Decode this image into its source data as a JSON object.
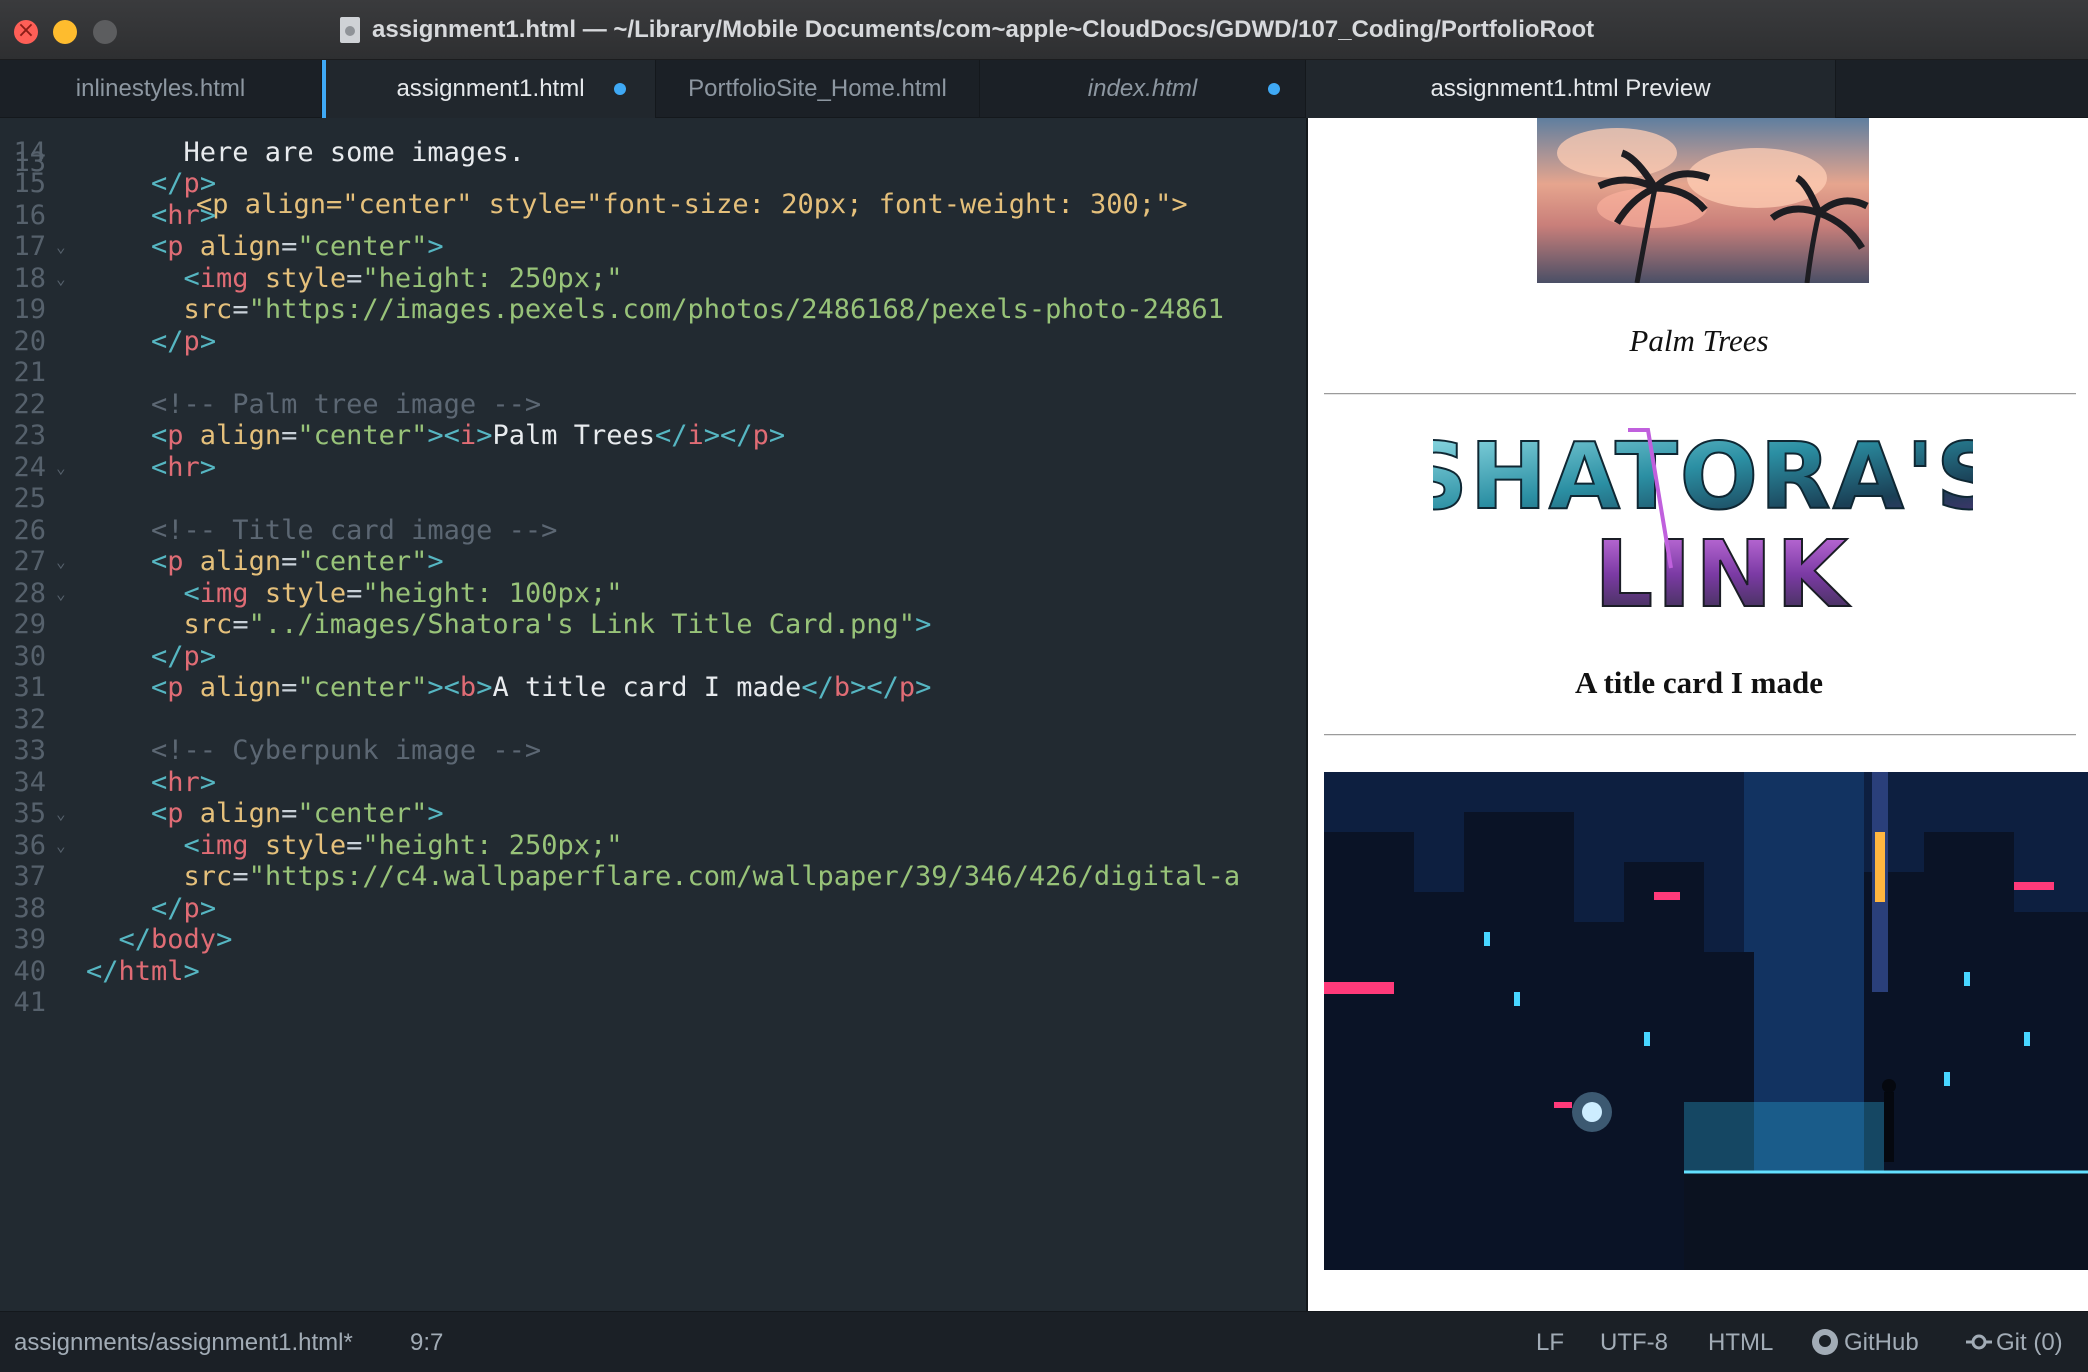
{
  "window": {
    "title": "assignment1.html — ~/Library/Mobile Documents/com~apple~CloudDocs/GDWD/107_Coding/PortfolioRoot"
  },
  "tabs": [
    {
      "label": "inlinestyles.html",
      "modified": false,
      "italic": false,
      "active": false
    },
    {
      "label": "assignment1.html",
      "modified": true,
      "italic": false,
      "active": true
    },
    {
      "label": "PortfolioSite_Home.html",
      "modified": false,
      "italic": false,
      "active": false
    },
    {
      "label": "index.html",
      "modified": true,
      "italic": true,
      "active": false
    },
    {
      "label": "assignment1.html Preview",
      "modified": false,
      "italic": false,
      "active": true
    }
  ],
  "editor": {
    "partial_top_line": "<p align=\"center\" style=\"font-size: 20px; font-weight: 300;\">",
    "lines": [
      {
        "n": "14",
        "segs": [
          [
            "txt",
            "      Here are some images."
          ]
        ]
      },
      {
        "n": "15",
        "segs": [
          [
            "br",
            "    </"
          ],
          [
            "tag",
            "p"
          ],
          [
            "br",
            ">"
          ]
        ]
      },
      {
        "n": "16",
        "segs": [
          [
            "br",
            "    <"
          ],
          [
            "tag",
            "hr"
          ],
          [
            "br",
            ">"
          ]
        ]
      },
      {
        "n": "17",
        "fold": true,
        "segs": [
          [
            "br",
            "    <"
          ],
          [
            "tag",
            "p"
          ],
          [
            "attr",
            " align"
          ],
          [
            "pun",
            "="
          ],
          [
            "str",
            "\"center\""
          ],
          [
            "br",
            ">"
          ]
        ]
      },
      {
        "n": "18",
        "fold": true,
        "segs": [
          [
            "br",
            "      <"
          ],
          [
            "tag",
            "img"
          ],
          [
            "attr",
            " style"
          ],
          [
            "pun",
            "="
          ],
          [
            "str",
            "\"height: 250px;\""
          ]
        ]
      },
      {
        "n": "19",
        "segs": [
          [
            "attr",
            "      src"
          ],
          [
            "pun",
            "="
          ],
          [
            "str",
            "\"https://images.pexels.com/photos/2486168/pexels-photo-24861"
          ]
        ]
      },
      {
        "n": "20",
        "segs": [
          [
            "br",
            "    </"
          ],
          [
            "tag",
            "p"
          ],
          [
            "br",
            ">"
          ]
        ]
      },
      {
        "n": "21",
        "segs": []
      },
      {
        "n": "22",
        "segs": [
          [
            "cmt",
            "    <!-- Palm tree image -->"
          ]
        ]
      },
      {
        "n": "23",
        "segs": [
          [
            "br",
            "    <"
          ],
          [
            "tag",
            "p"
          ],
          [
            "attr",
            " align"
          ],
          [
            "pun",
            "="
          ],
          [
            "str",
            "\"center\""
          ],
          [
            "br",
            "><"
          ],
          [
            "tag",
            "i"
          ],
          [
            "br",
            ">"
          ],
          [
            "txt",
            "Palm Trees"
          ],
          [
            "br",
            "</"
          ],
          [
            "tag",
            "i"
          ],
          [
            "br",
            "></"
          ],
          [
            "tag",
            "p"
          ],
          [
            "br",
            ">"
          ]
        ]
      },
      {
        "n": "24",
        "fold": true,
        "segs": [
          [
            "br",
            "    <"
          ],
          [
            "tag",
            "hr"
          ],
          [
            "br",
            ">"
          ]
        ]
      },
      {
        "n": "25",
        "segs": []
      },
      {
        "n": "26",
        "segs": [
          [
            "cmt",
            "    <!-- Title card image -->"
          ]
        ]
      },
      {
        "n": "27",
        "fold": true,
        "segs": [
          [
            "br",
            "    <"
          ],
          [
            "tag",
            "p"
          ],
          [
            "attr",
            " align"
          ],
          [
            "pun",
            "="
          ],
          [
            "str",
            "\"center\""
          ],
          [
            "br",
            ">"
          ]
        ]
      },
      {
        "n": "28",
        "fold": true,
        "segs": [
          [
            "br",
            "      <"
          ],
          [
            "tag",
            "img"
          ],
          [
            "attr",
            " style"
          ],
          [
            "pun",
            "="
          ],
          [
            "str",
            "\"height: 100px;\""
          ]
        ]
      },
      {
        "n": "29",
        "segs": [
          [
            "attr",
            "      src"
          ],
          [
            "pun",
            "="
          ],
          [
            "str",
            "\"../images/Shatora's Link Title Card.png\""
          ],
          [
            "br",
            ">"
          ]
        ]
      },
      {
        "n": "30",
        "segs": [
          [
            "br",
            "    </"
          ],
          [
            "tag",
            "p"
          ],
          [
            "br",
            ">"
          ]
        ]
      },
      {
        "n": "31",
        "segs": [
          [
            "br",
            "    <"
          ],
          [
            "tag",
            "p"
          ],
          [
            "attr",
            " align"
          ],
          [
            "pun",
            "="
          ],
          [
            "str",
            "\"center\""
          ],
          [
            "br",
            "><"
          ],
          [
            "tag",
            "b"
          ],
          [
            "br",
            ">"
          ],
          [
            "txt",
            "A title card I made"
          ],
          [
            "br",
            "</"
          ],
          [
            "tag",
            "b"
          ],
          [
            "br",
            "></"
          ],
          [
            "tag",
            "p"
          ],
          [
            "br",
            ">"
          ]
        ]
      },
      {
        "n": "32",
        "segs": []
      },
      {
        "n": "33",
        "segs": [
          [
            "cmt",
            "    <!-- Cyberpunk image -->"
          ]
        ]
      },
      {
        "n": "34",
        "segs": [
          [
            "br",
            "    <"
          ],
          [
            "tag",
            "hr"
          ],
          [
            "br",
            ">"
          ]
        ]
      },
      {
        "n": "35",
        "fold": true,
        "segs": [
          [
            "br",
            "    <"
          ],
          [
            "tag",
            "p"
          ],
          [
            "attr",
            " align"
          ],
          [
            "pun",
            "="
          ],
          [
            "str",
            "\"center\""
          ],
          [
            "br",
            ">"
          ]
        ]
      },
      {
        "n": "36",
        "fold": true,
        "segs": [
          [
            "br",
            "      <"
          ],
          [
            "tag",
            "img"
          ],
          [
            "attr",
            " style"
          ],
          [
            "pun",
            "="
          ],
          [
            "str",
            "\"height: 250px;\""
          ]
        ]
      },
      {
        "n": "37",
        "segs": [
          [
            "attr",
            "      src"
          ],
          [
            "pun",
            "="
          ],
          [
            "str",
            "\"https://c4.wallpaperflare.com/wallpaper/39/346/426/digital-a"
          ]
        ]
      },
      {
        "n": "38",
        "segs": [
          [
            "br",
            "    </"
          ],
          [
            "tag",
            "p"
          ],
          [
            "br",
            ">"
          ]
        ]
      },
      {
        "n": "39",
        "segs": [
          [
            "br",
            "  </"
          ],
          [
            "tag",
            "body"
          ],
          [
            "br",
            ">"
          ]
        ]
      },
      {
        "n": "40",
        "segs": [
          [
            "br",
            "</"
          ],
          [
            "tag",
            "html"
          ],
          [
            "br",
            ">"
          ]
        ]
      },
      {
        "n": "41",
        "segs": []
      }
    ]
  },
  "preview": {
    "palm_caption": "Palm Trees",
    "logo_line1": "SHATORA'S",
    "logo_line2": "LINK",
    "title_caption": "A title card I made"
  },
  "status": {
    "path": "assignments/assignment1.html*",
    "cursor": "9:7",
    "line_ending": "LF",
    "encoding": "UTF-8",
    "grammar": "HTML",
    "github": "GitHub",
    "git": "Git (0)"
  },
  "colors": {
    "accent": "#3fa9f5",
    "tag": "#e06c75",
    "attr": "#e5c07b",
    "string": "#98c379",
    "comment": "#5c6773"
  }
}
